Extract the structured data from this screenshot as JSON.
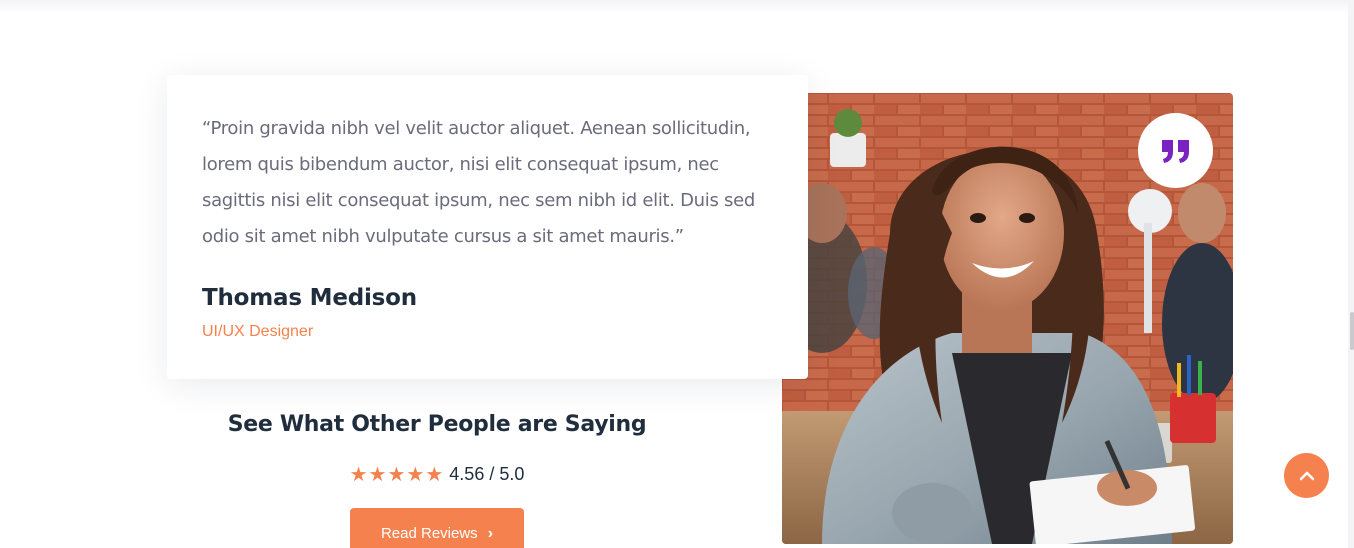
{
  "testimonial": {
    "quote": "“Proin gravida nibh vel velit auctor aliquet. Aenean sollicitudin, lorem quis bibendum auctor, nisi elit consequat ipsum, nec sagittis nisi elit consequat ipsum, nec sem nibh id elit. Duis sed odio sit amet nibh vulputate cursus a sit amet mauris.”",
    "author_name": "Thomas Medison",
    "author_role": "UI/UX Designer"
  },
  "reviews": {
    "heading": "See What Other People are Saying",
    "stars": "★★★★★",
    "rating_text": "4.56 / 5.0",
    "rating_value": 4.56,
    "rating_max": 5,
    "button_label": "Read Reviews"
  },
  "icons": {
    "quote_badge": "quote-icon",
    "back_to_top": "chevron-up-icon",
    "button_chevron": "chevron-right-icon"
  },
  "colors": {
    "accent": "#f5824e",
    "heading": "#1f2d3d",
    "body_text": "#6b6b7b",
    "quote_icon": "#7b22c2"
  }
}
